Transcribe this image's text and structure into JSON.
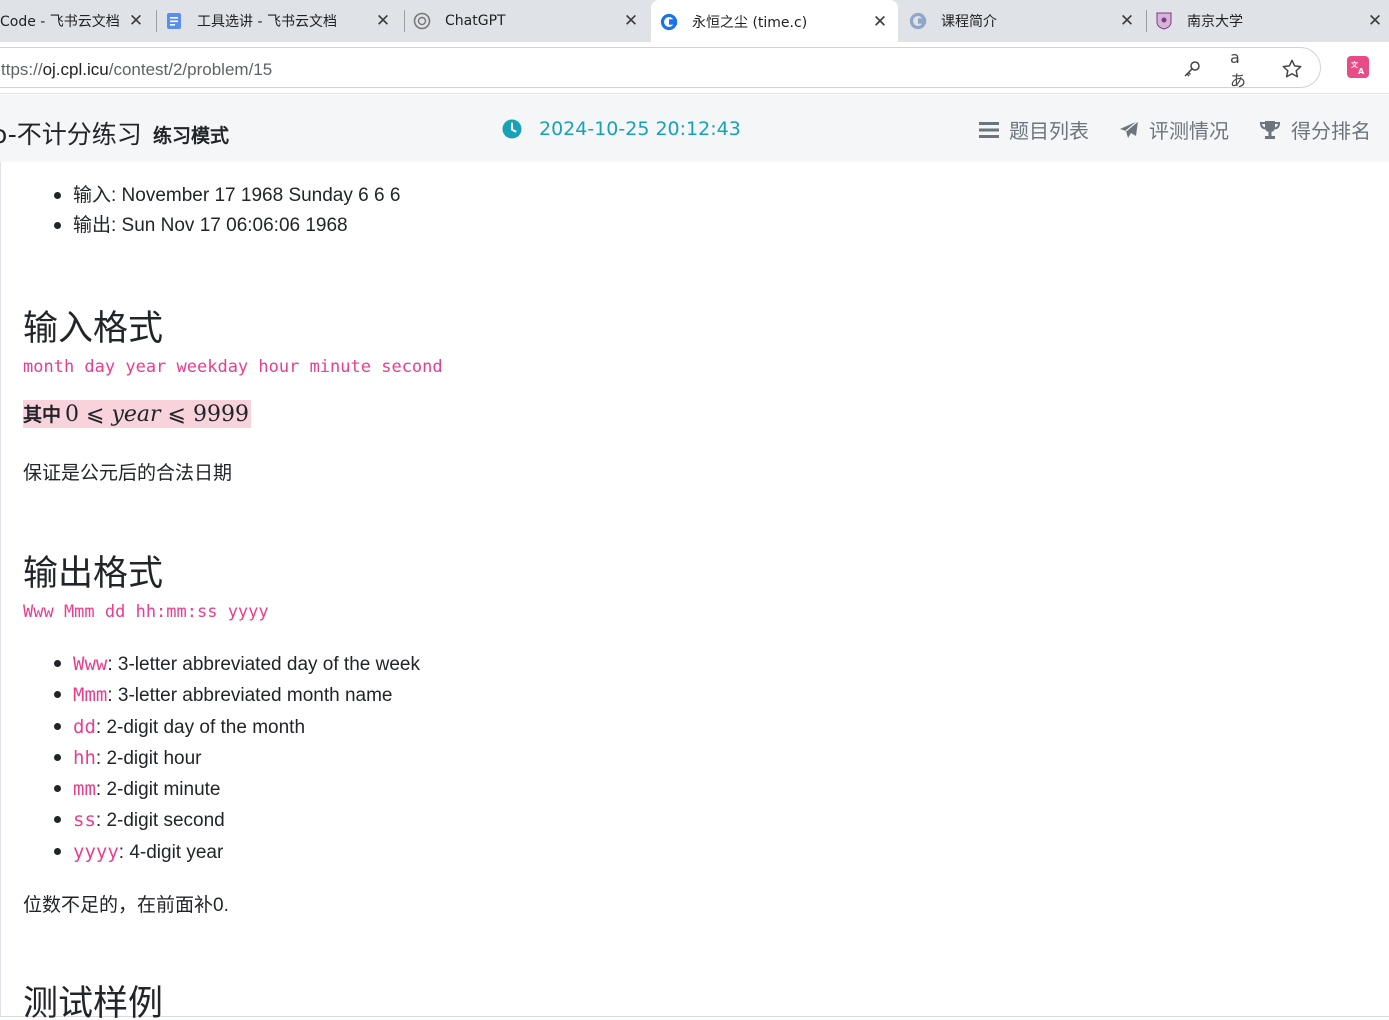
{
  "browser": {
    "tabs": [
      {
        "title": "Code - 飞书云文档",
        "icon": "feishu-code-icon",
        "active": false
      },
      {
        "title": "工具选讲 - 飞书云文档",
        "icon": "feishu-doc-icon",
        "active": false
      },
      {
        "title": "ChatGPT",
        "icon": "chatgpt-icon",
        "active": false
      },
      {
        "title": "永恒之尘 (time.c)",
        "icon": "oj-logo-icon",
        "active": true
      },
      {
        "title": "课程简介",
        "icon": "oj-logo-icon",
        "active": false
      },
      {
        "title": "南京大学",
        "icon": "nju-logo-icon",
        "active": false
      }
    ],
    "close_glyph": "✕",
    "url_prefix": "ttps://",
    "url_host": "oj.cpl.icu",
    "url_path": "/contest/2/problem/15",
    "read_aloud_label": "aあ"
  },
  "header": {
    "contest_title": "o-不计分练习",
    "mode_label": "练习模式",
    "clock_time": "2024-10-25 20:12:43",
    "nav": [
      {
        "label": "题目列表",
        "icon": "list-icon"
      },
      {
        "label": "评测情况",
        "icon": "paper-plane-icon"
      },
      {
        "label": "得分排名",
        "icon": "trophy-icon"
      }
    ]
  },
  "problem": {
    "example_items": [
      "输入: November 17 1968 Sunday 6 6 6",
      "输出: Sun Nov 17 06:06:06 1968"
    ],
    "input_heading": "输入格式",
    "input_format": "month day year weekday hour minute second",
    "constraint_prefix": "其中",
    "constraint_lo": "0",
    "constraint_var": "year",
    "constraint_hi": "9999",
    "constraint_op": "⩽",
    "valid_date_note": "保证是公元后的合法日期",
    "output_heading": "输出格式",
    "output_format": "Www Mmm dd hh:mm:ss yyyy",
    "fields": [
      {
        "code": "Www",
        "desc": ": 3-letter abbreviated day of the week"
      },
      {
        "code": "Mmm",
        "desc": ": 3-letter abbreviated month name"
      },
      {
        "code": "dd",
        "desc": ": 2-digit day of the month"
      },
      {
        "code": "hh",
        "desc": ": 2-digit hour"
      },
      {
        "code": "mm",
        "desc": ": 2-digit minute"
      },
      {
        "code": "ss",
        "desc": ": 2-digit second"
      },
      {
        "code": "yyyy",
        "desc": ": 4-digit year"
      }
    ],
    "padding_note": "位数不足的，在前面补0.",
    "samples_heading": "测试样例"
  },
  "colors": {
    "accent_teal": "#17a2b8",
    "code_pink": "#e83e8c",
    "muted_gray": "#6c757d",
    "highlight_pink": "#f8d3dc"
  }
}
